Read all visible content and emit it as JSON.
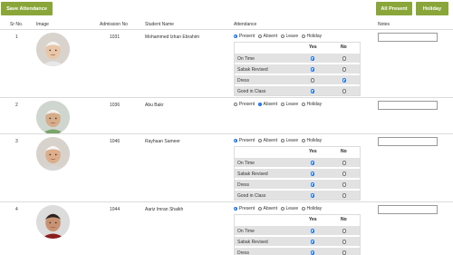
{
  "toolbar": {
    "save_label": "Save Attendance",
    "all_present_label": "All Present",
    "holiday_label": "Holiday"
  },
  "colors": {
    "button": "#8aa63a",
    "radio_selected": "#1a73e8",
    "subrow_bg": "#e2e2e2"
  },
  "table": {
    "headers": {
      "sr": "Sr No.",
      "image": "Image",
      "admission": "Admission No",
      "name": "Student Name",
      "attendance": "Attendance",
      "notes": "Notes"
    }
  },
  "attendance_options": [
    "Present",
    "Absent",
    "Leave",
    "Holiday"
  ],
  "sub_headers": {
    "yes": "Yes",
    "no": "No"
  },
  "criteria": [
    "On Time",
    "Sabak Revised",
    "Dress",
    "Good in Class"
  ],
  "students": [
    {
      "sr": "1",
      "admission": "1031",
      "name": "Mohammed Izhan Ebrahim",
      "status": "Present",
      "avatar_icon": "student-photo-icon",
      "criteria": [
        "Yes",
        "Yes",
        "No",
        "Yes"
      ]
    },
    {
      "sr": "2",
      "admission": "1036",
      "name": "Abu Bakr",
      "status": "Absent",
      "avatar_icon": "student-photo-icon",
      "criteria": []
    },
    {
      "sr": "3",
      "admission": "1046",
      "name": "Rayhaan Sameer",
      "status": "Present",
      "avatar_icon": "student-photo-icon",
      "criteria": [
        "Yes",
        "Yes",
        "Yes",
        "Yes"
      ]
    },
    {
      "sr": "4",
      "admission": "1044",
      "name": "Aariz Imran Shaikh",
      "status": "Present",
      "avatar_icon": "student-photo-icon",
      "criteria": [
        "Yes",
        "Yes",
        "Yes"
      ]
    }
  ]
}
